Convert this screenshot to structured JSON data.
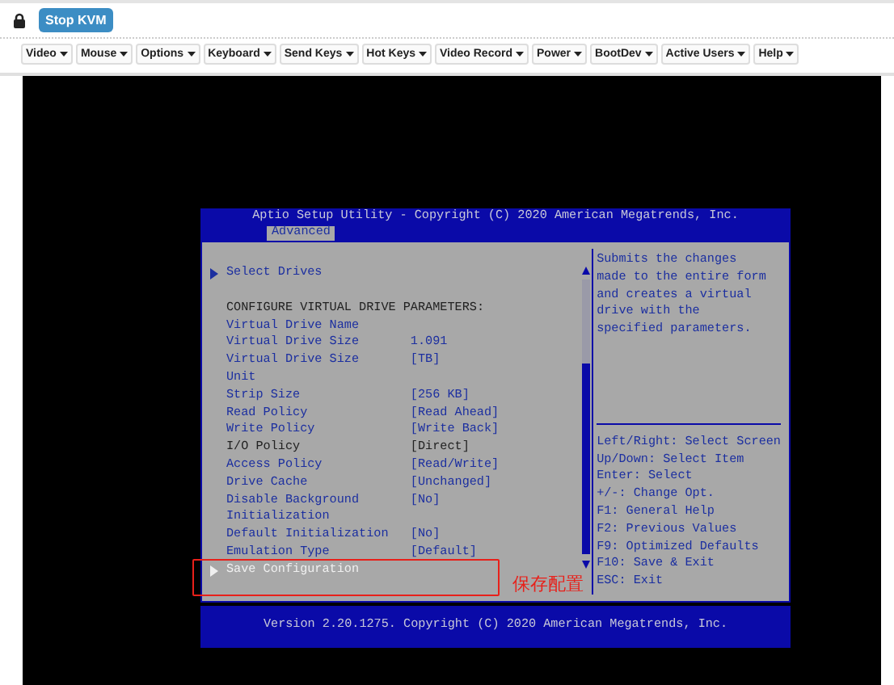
{
  "top_bar": {
    "stop_button": "Stop KVM"
  },
  "menus": [
    {
      "label": "Video"
    },
    {
      "label": "Mouse"
    },
    {
      "label": "Options"
    },
    {
      "label": "Keyboard"
    },
    {
      "label": "Send Keys"
    },
    {
      "label": "Hot Keys"
    },
    {
      "label": "Video Record"
    },
    {
      "label": "Power"
    },
    {
      "label": "BootDev"
    },
    {
      "label": "Active Users"
    },
    {
      "label": "Help"
    }
  ],
  "bios": {
    "title": "Aptio Setup Utility - Copyright (C) 2020 American Megatrends, Inc.",
    "tabs": [
      {
        "label": "Advanced",
        "selected": true
      }
    ],
    "items": [
      {
        "kind": "submenu",
        "label": "Select Drives",
        "selected": false
      },
      {
        "kind": "heading",
        "label": "CONFIGURE VIRTUAL DRIVE PARAMETERS:"
      },
      {
        "kind": "setting",
        "label": "Virtual Drive Name",
        "editable": true
      },
      {
        "kind": "setting",
        "label": "Virtual Drive Size",
        "value": "1.091",
        "editable": true
      },
      {
        "kind": "setting",
        "label": "Virtual Drive Size Unit",
        "value": "[TB]",
        "editable": true
      },
      {
        "kind": "setting",
        "label": "Strip Size",
        "value": "[256 KB]",
        "editable": true
      },
      {
        "kind": "setting",
        "label": "Read Policy",
        "value": "[Read Ahead]",
        "editable": true
      },
      {
        "kind": "setting",
        "label": "Write Policy",
        "value": "[Write Back]",
        "editable": true
      },
      {
        "kind": "setting",
        "label": "I/O Policy",
        "value": "[Direct]",
        "editable": false
      },
      {
        "kind": "setting",
        "label": "Access Policy",
        "value": "[Read/Write]",
        "editable": true
      },
      {
        "kind": "setting",
        "label": "Drive Cache",
        "value": "[Unchanged]",
        "editable": true
      },
      {
        "kind": "setting",
        "label": "Disable Background Initialization",
        "value": "[No]",
        "editable": true
      },
      {
        "kind": "setting",
        "label": "Default Initialization",
        "value": "[No]",
        "editable": true
      },
      {
        "kind": "setting",
        "label": "Emulation Type",
        "value": "[Default]",
        "editable": true
      },
      {
        "kind": "submenu",
        "label": "Save Configuration",
        "selected": true
      }
    ],
    "help_text": "Submits the changes made to the entire form and creates a virtual drive with the specified parameters.",
    "key_help": [
      "Left/Right: Select Screen",
      "Up/Down: Select Item",
      "Enter: Select",
      "+/-: Change Opt.",
      "F1: General Help",
      "F2: Previous Values",
      "F9: Optimized Defaults",
      "F10: Save & Exit",
      "ESC: Exit"
    ],
    "footer": "Version 2.20.1275. Copyright (C) 2020 American Megatrends, Inc."
  },
  "annotation": {
    "text": "保存配置"
  }
}
